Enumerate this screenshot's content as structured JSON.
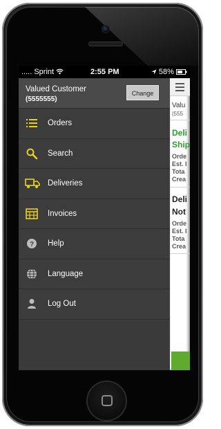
{
  "status_bar": {
    "carrier": "..... Sprint",
    "time": "2:55 PM",
    "battery": "58%"
  },
  "drawer": {
    "customer_name": "Valued Customer",
    "customer_number": "(5555555)",
    "change_label": "Change",
    "items": [
      {
        "label": "Orders",
        "icon": "list-icon"
      },
      {
        "label": "Search",
        "icon": "magnifier-icon"
      },
      {
        "label": "Deliveries",
        "icon": "truck-icon"
      },
      {
        "label": "Invoices",
        "icon": "invoice-table-icon"
      },
      {
        "label": "Help",
        "icon": "help-circle-icon"
      },
      {
        "label": "Language",
        "icon": "globe-icon"
      },
      {
        "label": "Log Out",
        "icon": "user-icon"
      }
    ]
  },
  "content": {
    "header_line1": "Valu",
    "header_line2": "(555",
    "card1": {
      "title1": "Deli",
      "title2": "Ship",
      "line1": "Orde",
      "line2": "Est. I",
      "line3": "Tota",
      "line4": "Crea"
    },
    "card2": {
      "title1": "Deli",
      "title2": "Not",
      "line1": "Orde",
      "line2": "Est. I",
      "line3": "Tota",
      "line4": "Crea"
    }
  },
  "colors": {
    "accent_yellow": "#e8d21a",
    "drawer_bg": "#3c3c3c",
    "status_green": "#2e9c2e"
  }
}
